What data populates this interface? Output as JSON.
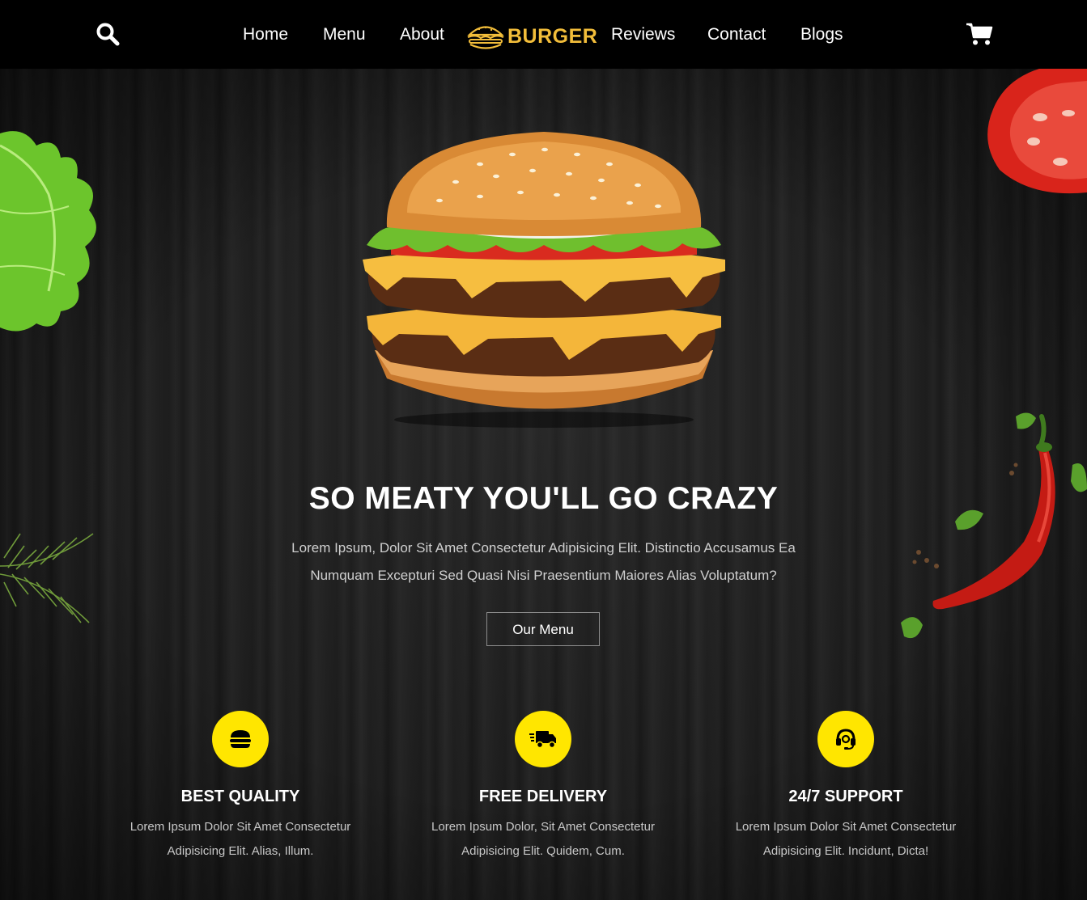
{
  "nav": {
    "links": [
      "Home",
      "Menu",
      "About",
      "Reviews",
      "Contact",
      "Blogs"
    ],
    "logo_text": "BURGER",
    "search_icon": "search-icon",
    "cart_icon": "shopping-cart-icon"
  },
  "hero": {
    "title": "SO MEATY YOU'LL GO CRAZY",
    "text": "Lorem Ipsum, Dolor Sit Amet Consectetur Adipisicing Elit. Distinctio Accusamus Ea Numquam Excepturi Sed Quasi Nisi Praesentium Maiores Alias Voluptatum?",
    "button_label": "Our Menu"
  },
  "features": [
    {
      "icon": "hamburger-icon",
      "title": "BEST QUALITY",
      "text": "Lorem Ipsum Dolor Sit Amet Consectetur Adipisicing Elit. Alias, Illum."
    },
    {
      "icon": "delivery-truck-icon",
      "title": "FREE DELIVERY",
      "text": "Lorem Ipsum Dolor, Sit Amet Consectetur Adipisicing Elit. Quidem, Cum."
    },
    {
      "icon": "headset-icon",
      "title": "24/7 SUPPORT",
      "text": "Lorem Ipsum Dolor Sit Amet Consectetur Adipisicing Elit. Incidunt, Dicta!"
    }
  ],
  "colors": {
    "accent_yellow": "#ffe600",
    "logo_gold": "#f2bd3a",
    "header_bg": "#000000",
    "background": "#1c1c1c"
  }
}
